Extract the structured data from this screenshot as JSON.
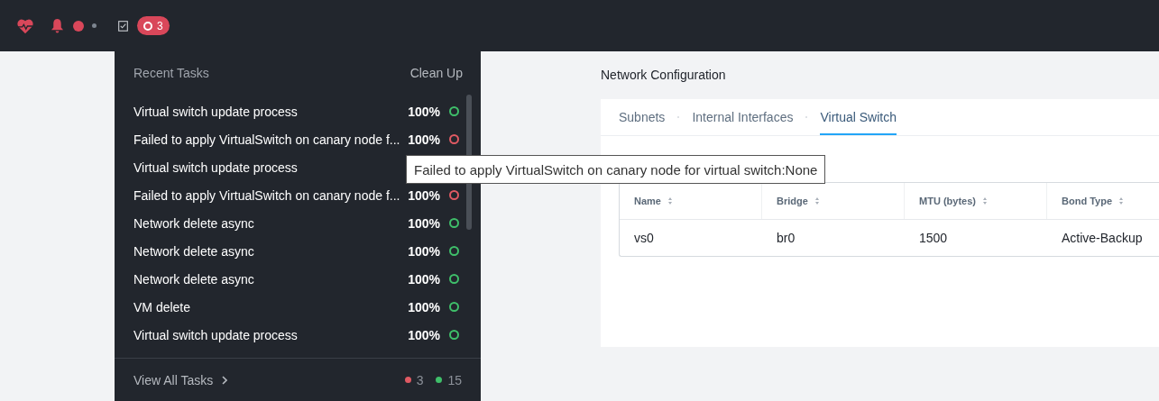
{
  "top_bar": {
    "task_badge": "3"
  },
  "tasks_panel": {
    "title": "Recent Tasks",
    "clean_up": "Clean Up",
    "tasks": [
      {
        "name": "Virtual switch update process",
        "percent": "100%",
        "failed": false
      },
      {
        "name": "Failed to apply VirtualSwitch on canary node f...",
        "percent": "100%",
        "failed": true
      },
      {
        "name": "Virtual switch update process"
      },
      {
        "name": "Failed to apply VirtualSwitch on canary node f...",
        "percent": "100%",
        "failed": true
      },
      {
        "name": "Network delete async",
        "percent": "100%",
        "failed": false
      },
      {
        "name": "Network delete async",
        "percent": "100%",
        "failed": false
      },
      {
        "name": "Network delete async",
        "percent": "100%",
        "failed": false
      },
      {
        "name": "VM delete",
        "percent": "100%",
        "failed": false
      },
      {
        "name": "Virtual switch update process",
        "percent": "100%",
        "failed": false
      }
    ],
    "view_all": "View All Tasks",
    "failed_count": "3",
    "success_count": "15"
  },
  "tooltip": "Failed to apply VirtualSwitch on canary node for virtual switch:None",
  "network_configuration": {
    "title": "Network Configuration",
    "tabs": [
      {
        "label": "Subnets",
        "selected": false
      },
      {
        "label": "Internal Interfaces",
        "selected": false
      },
      {
        "label": "Virtual Switch",
        "selected": true
      }
    ],
    "table": {
      "columns": [
        "Name",
        "Bridge",
        "MTU (bytes)",
        "Bond Type"
      ],
      "rows": [
        [
          "vs0",
          "br0",
          "1500",
          "Active-Backup"
        ]
      ]
    }
  }
}
